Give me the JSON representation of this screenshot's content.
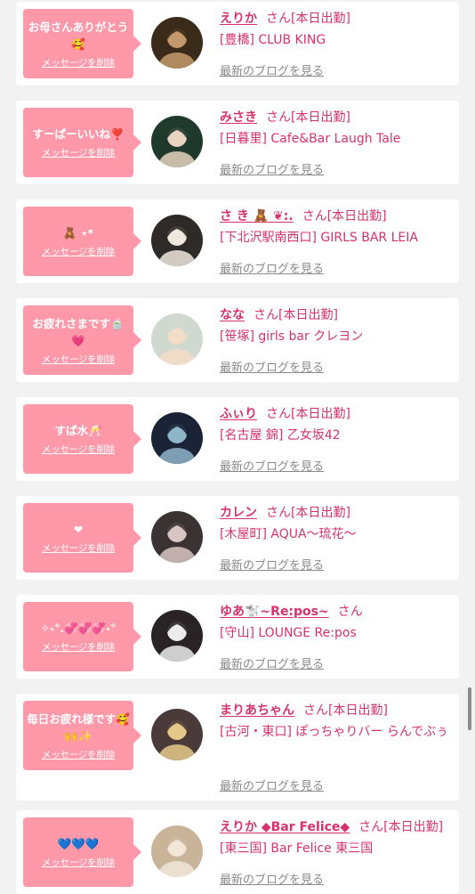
{
  "colors": {
    "bubble": "#ff99aa",
    "accent": "#d6336c",
    "link_gray": "#8a8a8a",
    "background": "#f2f2f2"
  },
  "items": [
    {
      "message": "お母さんありがとう🥰",
      "delete_label": "メッセージを削除",
      "name": "えりか",
      "honorific": "さん[本日出勤]",
      "shop": "[豊橋] CLUB KING",
      "blog_label": "最新のブログを見る",
      "avatar_colors": [
        "#3a2a1a",
        "#c49a6c"
      ]
    },
    {
      "message": "すーぱーいいね❣️",
      "delete_label": "メッセージを削除",
      "name": "みさき",
      "honorific": "さん[本日出勤]",
      "shop": "[日暮里] Cafe&Bar Laugh Tale",
      "blog_label": "最新のブログを見る",
      "avatar_colors": [
        "#1f3a2c",
        "#e8d4c0"
      ]
    },
    {
      "message": "🧸 ⋆*",
      "delete_label": "メッセージを削除",
      "name": "さ き 🧸 ❦:.",
      "honorific": "さん[本日出勤]",
      "shop": "[下北沢駅南西口] GIRLS BAR LEIA",
      "blog_label": "最新のブログを見る",
      "avatar_colors": [
        "#2d2a28",
        "#efe8df"
      ]
    },
    {
      "message": "お疲れさまです🍵💗",
      "delete_label": "メッセージを削除",
      "name": "なな",
      "honorific": "さん[本日出勤]",
      "shop": "[笹塚] girls bar クレヨン",
      "blog_label": "最新のブログを見る",
      "avatar_colors": [
        "#cfd9cf",
        "#f3dcc8"
      ]
    },
    {
      "message": "すば水🥂",
      "delete_label": "メッセージを削除",
      "name": "ふぃり",
      "honorific": "さん[本日出勤]",
      "shop": "[名古屋 錦] 乙女坂42",
      "blog_label": "最新のブログを見る",
      "avatar_colors": [
        "#1b2436",
        "#8fb5c9"
      ]
    },
    {
      "message": "❤︎",
      "delete_label": "メッセージを削除",
      "name": "カレン",
      "honorific": "さん[本日出勤]",
      "shop": "[木屋町] AQUA〜琉花〜",
      "blog_label": "最新のブログを見る",
      "avatar_colors": [
        "#3b3234",
        "#d8c6c3"
      ]
    },
    {
      "message": "✧˖°.💞💞💞˖°",
      "delete_label": "メッセージを削除",
      "name": "ゆあ🐩~Re:pos~",
      "honorific": "さん",
      "shop": "[守山] LOUNGE Re:pos",
      "blog_label": "最新のブログを見る",
      "avatar_colors": [
        "#2a2326",
        "#ececec"
      ]
    },
    {
      "message": "毎日お疲れ様です🥰🙌✨",
      "delete_label": "メッセージを削除",
      "name": "まりあちゃん",
      "honorific": "さん[本日出勤]",
      "shop": "[古河・東口] ぽっちゃりバー らんでぶぅ",
      "blog_label": "最新のブログを見る",
      "avatar_colors": [
        "#4a3a3a",
        "#e6c98a"
      ]
    },
    {
      "message": "💙💙💙",
      "delete_label": "メッセージを削除",
      "name": "えりか ◆Bar Felice◆",
      "honorific": "さん[本日出勤]",
      "shop": "[東三国] Bar Felice 東三国",
      "blog_label": "最新のブログを見る",
      "avatar_colors": [
        "#c9b49a",
        "#f1e6d8"
      ]
    }
  ]
}
